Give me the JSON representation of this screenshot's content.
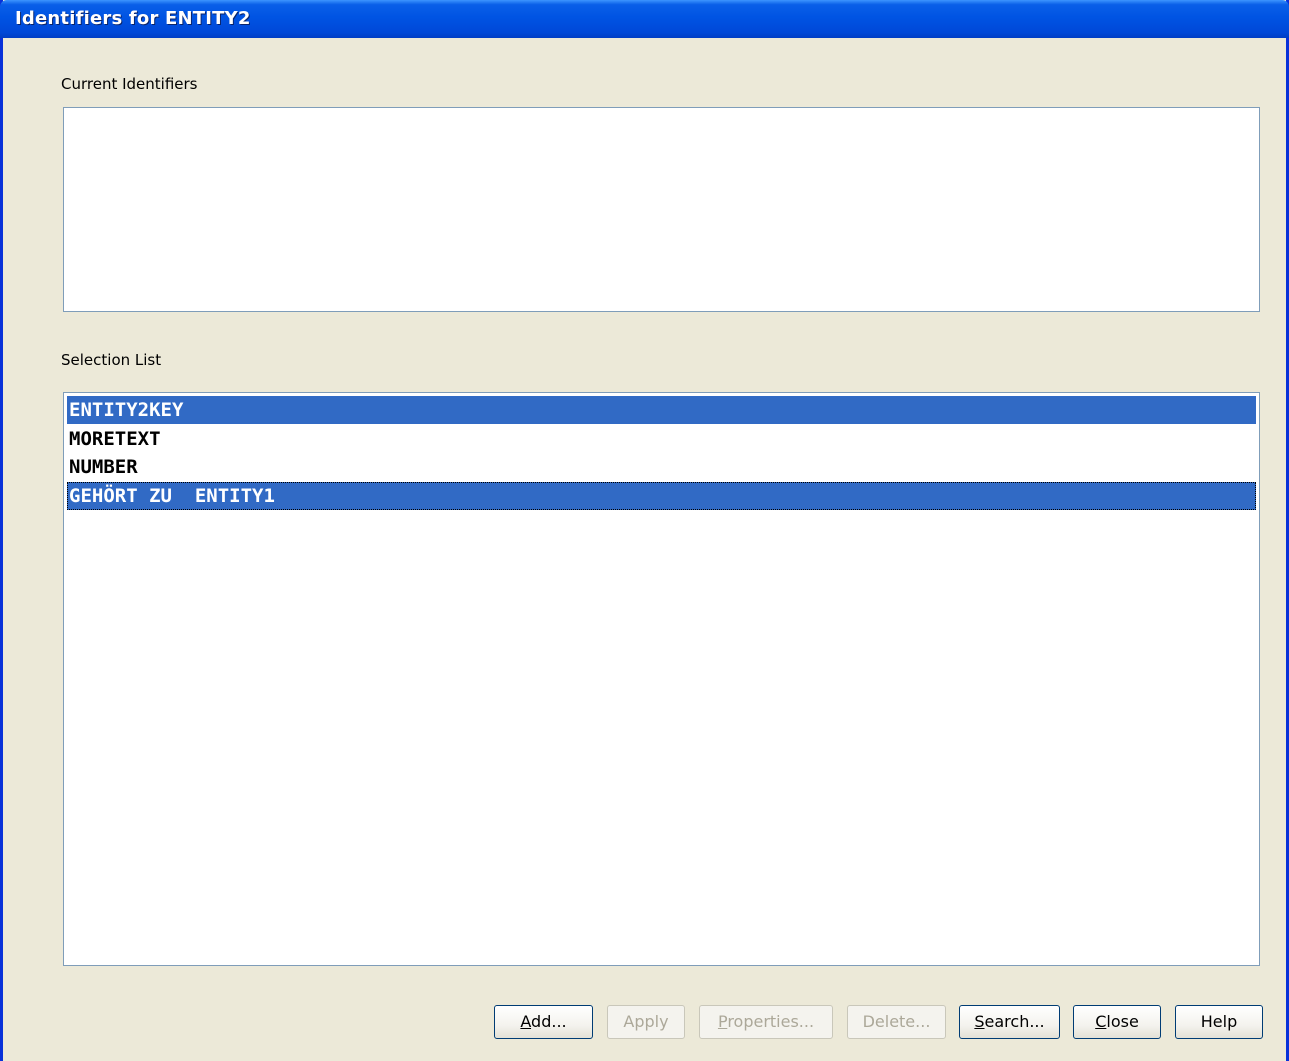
{
  "window": {
    "title": "Identifiers for ENTITY2"
  },
  "current_identifiers": {
    "label": "Current Identifiers",
    "items": []
  },
  "selection_list": {
    "label": "Selection List",
    "items": [
      {
        "text": "ENTITY2KEY",
        "selected": true
      },
      {
        "text": "MORETEXT",
        "selected": false
      },
      {
        "text": "NUMBER",
        "selected": false
      },
      {
        "text": "GEHÖRT ZU  ENTITY1",
        "selected": true,
        "focused": true
      }
    ]
  },
  "buttons": {
    "add": {
      "mnemonic": "A",
      "rest": "dd...",
      "enabled": true
    },
    "apply": {
      "label": "Apply",
      "enabled": false
    },
    "properties": {
      "mnemonic": "P",
      "rest": "roperties...",
      "enabled": false
    },
    "delete": {
      "label": "Delete...",
      "enabled": false
    },
    "search": {
      "mnemonic": "S",
      "rest": "earch...",
      "enabled": true
    },
    "close": {
      "mnemonic": "C",
      "rest": "lose",
      "enabled": true
    },
    "help": {
      "label": "Help",
      "enabled": true
    }
  },
  "colors": {
    "selection": "#316ac5",
    "titlebar": "#0054e3",
    "dialog_bg": "#ece9d8"
  }
}
